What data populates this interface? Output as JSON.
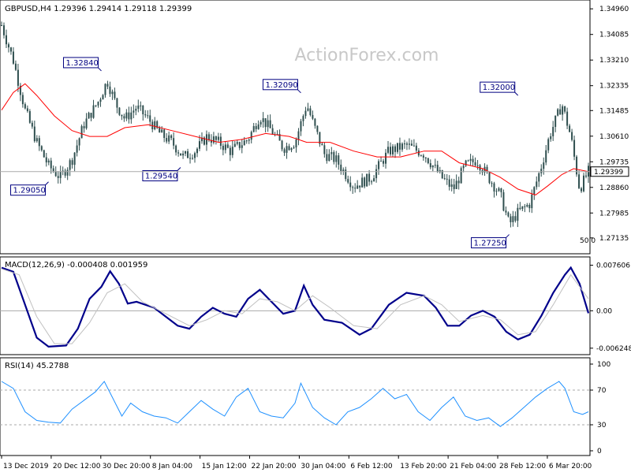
{
  "chart_data": [
    {
      "type": "candlestick",
      "panel": "price",
      "title": "GBPUSD,H4  1.29396 1.29414 1.29118 1.29399",
      "watermark": "ActionForex.com",
      "ylim": [
        1.267,
        1.351
      ],
      "yticks": [
        "1.34960",
        "1.34085",
        "1.33210",
        "1.32335",
        "1.31485",
        "1.30610",
        "1.29735",
        "1.28860",
        "1.27985",
        "1.27135"
      ],
      "current_price": "1.29399",
      "ma_label": "50.0",
      "colors": {
        "candle": "#2f4f4f",
        "ma": "#ff0000",
        "label_border": "#000080",
        "current_line": "#a9a9a9"
      },
      "annotations": [
        {
          "x": 0.08,
          "value": 1.2905,
          "text": "1.29050"
        },
        {
          "x": 0.17,
          "value": 1.3284,
          "text": "1.32840"
        },
        {
          "x": 0.305,
          "value": 1.2954,
          "text": "1.29540"
        },
        {
          "x": 0.51,
          "value": 1.3209,
          "text": "1.32090"
        },
        {
          "x": 0.865,
          "value": 1.2725,
          "text": "1.27250"
        },
        {
          "x": 0.88,
          "value": 1.32,
          "text": "1.32000"
        }
      ],
      "price_path": [
        {
          "x": 0.0,
          "y": 1.344
        },
        {
          "x": 0.02,
          "y": 1.332
        },
        {
          "x": 0.04,
          "y": 1.315
        },
        {
          "x": 0.06,
          "y": 1.304
        },
        {
          "x": 0.08,
          "y": 1.296
        },
        {
          "x": 0.1,
          "y": 1.292
        },
        {
          "x": 0.12,
          "y": 1.298
        },
        {
          "x": 0.14,
          "y": 1.31
        },
        {
          "x": 0.165,
          "y": 1.318
        },
        {
          "x": 0.18,
          "y": 1.325
        },
        {
          "x": 0.195,
          "y": 1.317
        },
        {
          "x": 0.21,
          "y": 1.312
        },
        {
          "x": 0.23,
          "y": 1.316
        },
        {
          "x": 0.25,
          "y": 1.312
        },
        {
          "x": 0.27,
          "y": 1.307
        },
        {
          "x": 0.29,
          "y": 1.304
        },
        {
          "x": 0.31,
          "y": 1.299
        },
        {
          "x": 0.33,
          "y": 1.301
        },
        {
          "x": 0.35,
          "y": 1.306
        },
        {
          "x": 0.37,
          "y": 1.304
        },
        {
          "x": 0.39,
          "y": 1.301
        },
        {
          "x": 0.42,
          "y": 1.305
        },
        {
          "x": 0.44,
          "y": 1.313
        },
        {
          "x": 0.46,
          "y": 1.308
        },
        {
          "x": 0.48,
          "y": 1.302
        },
        {
          "x": 0.5,
          "y": 1.304
        },
        {
          "x": 0.52,
          "y": 1.317
        },
        {
          "x": 0.53,
          "y": 1.311
        },
        {
          "x": 0.55,
          "y": 1.3
        },
        {
          "x": 0.57,
          "y": 1.298
        },
        {
          "x": 0.6,
          "y": 1.289
        },
        {
          "x": 0.63,
          "y": 1.292
        },
        {
          "x": 0.66,
          "y": 1.301
        },
        {
          "x": 0.69,
          "y": 1.303
        },
        {
          "x": 0.72,
          "y": 1.3
        },
        {
          "x": 0.75,
          "y": 1.292
        },
        {
          "x": 0.77,
          "y": 1.288
        },
        {
          "x": 0.79,
          "y": 1.296
        },
        {
          "x": 0.81,
          "y": 1.298
        },
        {
          "x": 0.83,
          "y": 1.292
        },
        {
          "x": 0.85,
          "y": 1.286
        },
        {
          "x": 0.865,
          "y": 1.276
        },
        {
          "x": 0.88,
          "y": 1.28
        },
        {
          "x": 0.9,
          "y": 1.283
        },
        {
          "x": 0.92,
          "y": 1.296
        },
        {
          "x": 0.935,
          "y": 1.307
        },
        {
          "x": 0.955,
          "y": 1.317
        },
        {
          "x": 0.97,
          "y": 1.306
        },
        {
          "x": 0.985,
          "y": 1.288
        },
        {
          "x": 1.0,
          "y": 1.294
        }
      ],
      "ma_path": [
        {
          "x": 0.0,
          "y": 1.315
        },
        {
          "x": 0.02,
          "y": 1.321
        },
        {
          "x": 0.04,
          "y": 1.324
        },
        {
          "x": 0.06,
          "y": 1.32
        },
        {
          "x": 0.09,
          "y": 1.313
        },
        {
          "x": 0.12,
          "y": 1.308
        },
        {
          "x": 0.15,
          "y": 1.306
        },
        {
          "x": 0.18,
          "y": 1.306
        },
        {
          "x": 0.21,
          "y": 1.309
        },
        {
          "x": 0.25,
          "y": 1.31
        },
        {
          "x": 0.29,
          "y": 1.308
        },
        {
          "x": 0.33,
          "y": 1.306
        },
        {
          "x": 0.37,
          "y": 1.304
        },
        {
          "x": 0.41,
          "y": 1.305
        },
        {
          "x": 0.45,
          "y": 1.307
        },
        {
          "x": 0.49,
          "y": 1.306
        },
        {
          "x": 0.52,
          "y": 1.304
        },
        {
          "x": 0.56,
          "y": 1.304
        },
        {
          "x": 0.6,
          "y": 1.301
        },
        {
          "x": 0.64,
          "y": 1.299
        },
        {
          "x": 0.68,
          "y": 1.299
        },
        {
          "x": 0.72,
          "y": 1.301
        },
        {
          "x": 0.75,
          "y": 1.301
        },
        {
          "x": 0.78,
          "y": 1.297
        },
        {
          "x": 0.82,
          "y": 1.295
        },
        {
          "x": 0.85,
          "y": 1.292
        },
        {
          "x": 0.88,
          "y": 1.288
        },
        {
          "x": 0.91,
          "y": 1.286
        },
        {
          "x": 0.93,
          "y": 1.289
        },
        {
          "x": 0.955,
          "y": 1.293
        },
        {
          "x": 0.975,
          "y": 1.295
        },
        {
          "x": 1.0,
          "y": 1.294
        }
      ]
    },
    {
      "type": "line",
      "panel": "macd",
      "title": "MACD(12,26,9) -0.000408 0.001959",
      "ylim": [
        -0.0068,
        0.0082
      ],
      "yticks": [
        {
          "value": 0.007606,
          "label": "0.007606"
        },
        {
          "value": 0.0,
          "label": "0.00"
        },
        {
          "value": -0.006248,
          "label": "-0.006248"
        }
      ],
      "series": [
        {
          "colors": "#00008b",
          "values": [
            {
              "x": 0.0,
              "y": 0.0072
            },
            {
              "x": 0.02,
              "y": 0.0065
            },
            {
              "x": 0.04,
              "y": 0.001
            },
            {
              "x": 0.06,
              "y": -0.0045
            },
            {
              "x": 0.08,
              "y": -0.006
            },
            {
              "x": 0.11,
              "y": -0.0058
            },
            {
              "x": 0.13,
              "y": -0.003
            },
            {
              "x": 0.15,
              "y": 0.002
            },
            {
              "x": 0.17,
              "y": 0.004
            },
            {
              "x": 0.185,
              "y": 0.0066
            },
            {
              "x": 0.2,
              "y": 0.0045
            },
            {
              "x": 0.215,
              "y": 0.0012
            },
            {
              "x": 0.23,
              "y": 0.0015
            },
            {
              "x": 0.26,
              "y": 0.0005
            },
            {
              "x": 0.28,
              "y": -0.001
            },
            {
              "x": 0.3,
              "y": -0.0025
            },
            {
              "x": 0.32,
              "y": -0.003
            },
            {
              "x": 0.34,
              "y": -0.001
            },
            {
              "x": 0.36,
              "y": 0.0005
            },
            {
              "x": 0.38,
              "y": -0.0005
            },
            {
              "x": 0.4,
              "y": -0.001
            },
            {
              "x": 0.42,
              "y": 0.002
            },
            {
              "x": 0.44,
              "y": 0.0035
            },
            {
              "x": 0.46,
              "y": 0.0015
            },
            {
              "x": 0.48,
              "y": -0.0005
            },
            {
              "x": 0.5,
              "y": 0.0
            },
            {
              "x": 0.515,
              "y": 0.0042
            },
            {
              "x": 0.53,
              "y": 0.001
            },
            {
              "x": 0.55,
              "y": -0.0015
            },
            {
              "x": 0.58,
              "y": -0.002
            },
            {
              "x": 0.61,
              "y": -0.004
            },
            {
              "x": 0.63,
              "y": -0.003
            },
            {
              "x": 0.66,
              "y": 0.001
            },
            {
              "x": 0.69,
              "y": 0.003
            },
            {
              "x": 0.72,
              "y": 0.0025
            },
            {
              "x": 0.74,
              "y": 0.0005
            },
            {
              "x": 0.76,
              "y": -0.0025
            },
            {
              "x": 0.78,
              "y": -0.0025
            },
            {
              "x": 0.8,
              "y": -0.0008
            },
            {
              "x": 0.82,
              "y": 0.0
            },
            {
              "x": 0.84,
              "y": -0.001
            },
            {
              "x": 0.86,
              "y": -0.0035
            },
            {
              "x": 0.88,
              "y": -0.0048
            },
            {
              "x": 0.9,
              "y": -0.004
            },
            {
              "x": 0.92,
              "y": -0.0008
            },
            {
              "x": 0.94,
              "y": 0.003
            },
            {
              "x": 0.96,
              "y": 0.006
            },
            {
              "x": 0.97,
              "y": 0.0072
            },
            {
              "x": 0.985,
              "y": 0.0045
            },
            {
              "x": 1.0,
              "y": -0.0004
            }
          ]
        },
        {
          "colors": "#c0c0c0",
          "values": [
            {
              "x": 0.0,
              "y": 0.007
            },
            {
              "x": 0.03,
              "y": 0.006
            },
            {
              "x": 0.06,
              "y": -0.001
            },
            {
              "x": 0.09,
              "y": -0.0055
            },
            {
              "x": 0.12,
              "y": -0.0055
            },
            {
              "x": 0.15,
              "y": -0.002
            },
            {
              "x": 0.18,
              "y": 0.003
            },
            {
              "x": 0.21,
              "y": 0.0045
            },
            {
              "x": 0.24,
              "y": 0.0015
            },
            {
              "x": 0.28,
              "y": -0.0005
            },
            {
              "x": 0.32,
              "y": -0.0025
            },
            {
              "x": 0.35,
              "y": -0.0015
            },
            {
              "x": 0.38,
              "y": 0.0
            },
            {
              "x": 0.41,
              "y": -0.0005
            },
            {
              "x": 0.44,
              "y": 0.002
            },
            {
              "x": 0.47,
              "y": 0.0015
            },
            {
              "x": 0.5,
              "y": 0.0
            },
            {
              "x": 0.53,
              "y": 0.0025
            },
            {
              "x": 0.56,
              "y": 0.0005
            },
            {
              "x": 0.6,
              "y": -0.0025
            },
            {
              "x": 0.64,
              "y": -0.003
            },
            {
              "x": 0.68,
              "y": 0.001
            },
            {
              "x": 0.72,
              "y": 0.0025
            },
            {
              "x": 0.75,
              "y": 0.001
            },
            {
              "x": 0.78,
              "y": -0.0018
            },
            {
              "x": 0.82,
              "y": -0.0008
            },
            {
              "x": 0.85,
              "y": -0.0015
            },
            {
              "x": 0.88,
              "y": -0.004
            },
            {
              "x": 0.91,
              "y": -0.0035
            },
            {
              "x": 0.94,
              "y": 0.001
            },
            {
              "x": 0.97,
              "y": 0.006
            },
            {
              "x": 1.0,
              "y": 0.002
            }
          ]
        }
      ]
    },
    {
      "type": "line",
      "panel": "rsi",
      "title": "RSI(14) 45.2788",
      "ylim": [
        0,
        100
      ],
      "yticks": [
        {
          "value": 100,
          "label": "100"
        },
        {
          "value": 70,
          "label": "70"
        },
        {
          "value": 30,
          "label": "30"
        },
        {
          "value": 0,
          "label": "0"
        }
      ],
      "levels": [
        70,
        30
      ],
      "series": [
        {
          "colors": "#1e90ff",
          "values": [
            {
              "x": 0.0,
              "y": 80
            },
            {
              "x": 0.02,
              "y": 72
            },
            {
              "x": 0.04,
              "y": 45
            },
            {
              "x": 0.06,
              "y": 35
            },
            {
              "x": 0.08,
              "y": 33
            },
            {
              "x": 0.1,
              "y": 32
            },
            {
              "x": 0.12,
              "y": 48
            },
            {
              "x": 0.14,
              "y": 58
            },
            {
              "x": 0.16,
              "y": 68
            },
            {
              "x": 0.175,
              "y": 80
            },
            {
              "x": 0.19,
              "y": 60
            },
            {
              "x": 0.205,
              "y": 40
            },
            {
              "x": 0.22,
              "y": 55
            },
            {
              "x": 0.24,
              "y": 45
            },
            {
              "x": 0.26,
              "y": 40
            },
            {
              "x": 0.28,
              "y": 38
            },
            {
              "x": 0.3,
              "y": 32
            },
            {
              "x": 0.32,
              "y": 45
            },
            {
              "x": 0.34,
              "y": 58
            },
            {
              "x": 0.36,
              "y": 48
            },
            {
              "x": 0.38,
              "y": 40
            },
            {
              "x": 0.4,
              "y": 62
            },
            {
              "x": 0.42,
              "y": 72
            },
            {
              "x": 0.44,
              "y": 45
            },
            {
              "x": 0.46,
              "y": 40
            },
            {
              "x": 0.48,
              "y": 38
            },
            {
              "x": 0.5,
              "y": 55
            },
            {
              "x": 0.51,
              "y": 78
            },
            {
              "x": 0.53,
              "y": 50
            },
            {
              "x": 0.55,
              "y": 38
            },
            {
              "x": 0.57,
              "y": 30
            },
            {
              "x": 0.59,
              "y": 45
            },
            {
              "x": 0.61,
              "y": 50
            },
            {
              "x": 0.63,
              "y": 60
            },
            {
              "x": 0.65,
              "y": 72
            },
            {
              "x": 0.67,
              "y": 60
            },
            {
              "x": 0.69,
              "y": 65
            },
            {
              "x": 0.71,
              "y": 45
            },
            {
              "x": 0.73,
              "y": 35
            },
            {
              "x": 0.75,
              "y": 50
            },
            {
              "x": 0.77,
              "y": 62
            },
            {
              "x": 0.79,
              "y": 40
            },
            {
              "x": 0.81,
              "y": 35
            },
            {
              "x": 0.83,
              "y": 38
            },
            {
              "x": 0.85,
              "y": 28
            },
            {
              "x": 0.87,
              "y": 38
            },
            {
              "x": 0.89,
              "y": 50
            },
            {
              "x": 0.91,
              "y": 62
            },
            {
              "x": 0.93,
              "y": 72
            },
            {
              "x": 0.95,
              "y": 80
            },
            {
              "x": 0.96,
              "y": 72
            },
            {
              "x": 0.975,
              "y": 45
            },
            {
              "x": 0.99,
              "y": 42
            },
            {
              "x": 1.0,
              "y": 45
            }
          ]
        }
      ]
    }
  ],
  "xticks": [
    "13 Dec 2019",
    "20 Dec 12:00",
    "30 Dec 20:00",
    "8 Jan 04:00",
    "15 Jan 12:00",
    "22 Jan 20:00",
    "30 Jan 04:00",
    "6 Feb 12:00",
    "13 Feb 20:00",
    "21 Feb 04:00",
    "28 Feb 12:00",
    "6 Mar 20:00"
  ]
}
